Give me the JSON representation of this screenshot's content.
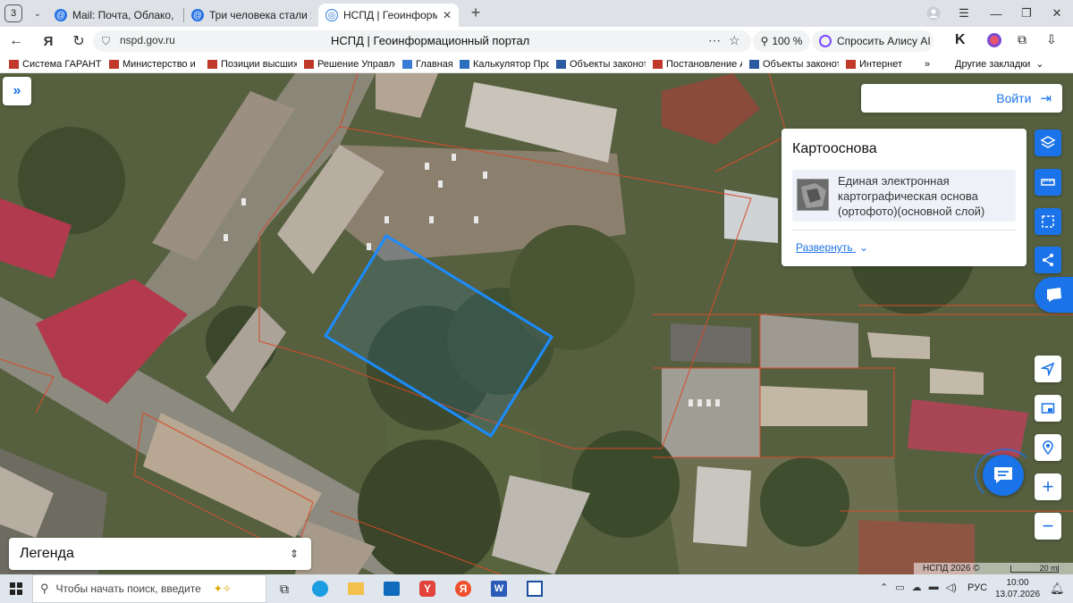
{
  "browser": {
    "tab_count": "3",
    "tabs": [
      {
        "label": "Mail: Почта, Облако, Кале",
        "icon": "mail-icon"
      },
      {
        "label": "Три человека стали жерт",
        "icon": "news-icon"
      },
      {
        "label": "НСПД | Геоинформаци",
        "icon": "nspd-icon",
        "active": true
      }
    ],
    "url": "nspd.gov.ru",
    "page_title": "НСПД | Геоинформационный портал",
    "zoom": "100 %",
    "alice_label": "Спросить Алису AI",
    "bookmarks": [
      {
        "label": "Система ГАРАНТ",
        "color": "#c0392b"
      },
      {
        "label": "Министерство и",
        "color": "#c0392b"
      },
      {
        "label": "Позиции высших",
        "color": "#c0392b"
      },
      {
        "label": "Решение Управле",
        "color": "#c0392b"
      },
      {
        "label": "Главная",
        "color": "#3a7bd5"
      },
      {
        "label": "Калькулятор Про",
        "color": "#2c6fbf"
      },
      {
        "label": "Объекты законот",
        "color": "#2c5aa0"
      },
      {
        "label": "Постановление А",
        "color": "#c0392b"
      },
      {
        "label": "Объекты законот",
        "color": "#2c5aa0"
      },
      {
        "label": "Интернет",
        "color": "#c0392b"
      }
    ],
    "more_bookmarks": "»",
    "other_bookmarks": "Другие закладки"
  },
  "map": {
    "login_label": "Войти",
    "legend_label": "Легенда",
    "basemap_panel": {
      "title": "Картооснова",
      "layer_name": "Единая электронная картографическая основа (ортофото)(основной слой)",
      "expand_label": "Развернуть"
    },
    "copyright": "НСПД 2026 ©",
    "scale": "20 m",
    "accent_color": "#1a8cff"
  },
  "taskbar": {
    "search_placeholder": "Чтобы начать поиск, введите",
    "lang": "РУС",
    "time": "10:00",
    "date": "13.07.2026"
  }
}
